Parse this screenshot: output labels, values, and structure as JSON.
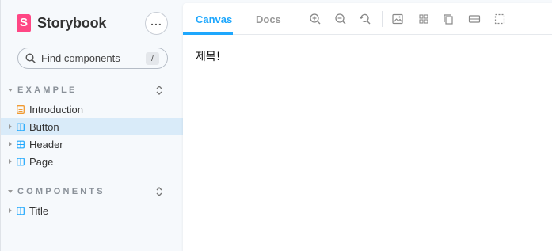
{
  "brand": {
    "name": "Storybook",
    "accent": "#ff4785"
  },
  "sidebar": {
    "more_icon": "more-horizontal-icon",
    "search": {
      "placeholder": "Find components",
      "shortcut": "/"
    },
    "groups": [
      {
        "label": "EXAMPLE",
        "items": [
          {
            "label": "Introduction",
            "icon": "document-icon",
            "selected": false
          },
          {
            "label": "Button",
            "icon": "component-icon",
            "selected": true
          },
          {
            "label": "Header",
            "icon": "component-icon",
            "selected": false
          },
          {
            "label": "Page",
            "icon": "component-icon",
            "selected": false
          }
        ]
      },
      {
        "label": "COMPONENTS",
        "items": [
          {
            "label": "Title",
            "icon": "component-icon",
            "selected": false
          }
        ]
      }
    ]
  },
  "toolbar": {
    "tabs": [
      {
        "label": "Canvas",
        "active": true
      },
      {
        "label": "Docs",
        "active": false
      }
    ],
    "tools": [
      "zoom-in-icon",
      "zoom-out-icon",
      "zoom-reset-icon",
      "background-icon",
      "grid-icon",
      "viewport-icon",
      "measure-icon",
      "outline-icon"
    ]
  },
  "canvas": {
    "text": "제목!"
  },
  "colors": {
    "active_tab": "#1ea7fd",
    "selected_row": "#d9ebf9"
  }
}
